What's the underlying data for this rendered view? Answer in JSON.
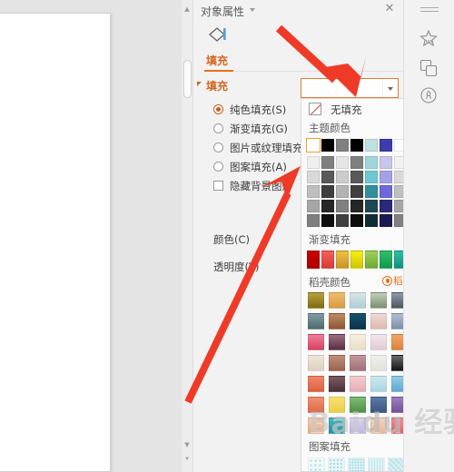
{
  "panel": {
    "title": "对象属性",
    "caret_icon": "chevron-down-icon",
    "close_icon": "close-icon",
    "shape_icon": "shape-fill-icon",
    "tab_label": "填充",
    "section_label": "填充",
    "options": [
      {
        "label": "纯色填充(S)",
        "type": "radio",
        "selected": true
      },
      {
        "label": "渐变填充(G)",
        "type": "radio",
        "selected": false
      },
      {
        "label": "图片或纹理填充(",
        "type": "radio",
        "selected": false
      },
      {
        "label": "图案填充(A)",
        "type": "radio",
        "selected": false
      },
      {
        "label": "隐藏背景图形",
        "type": "checkbox",
        "selected": false
      }
    ],
    "color_label": "颜色(C)",
    "transparency_label": "透明度(T)"
  },
  "fill_button": {
    "value": "",
    "arrow_icon": "dropdown-arrow-icon",
    "border_color": "#e07b33"
  },
  "popup": {
    "no_fill_label": "无填充",
    "no_fill_icon": "no-fill-icon",
    "theme_colors_label": "主题颜色",
    "gradient_fill_label": "渐变填充",
    "dk_colors_label": "稻壳颜色",
    "dk_member_badge": "稻壳会员专享",
    "dk_badge_icon": "member-crown-icon",
    "pattern_fill_label": "图案填充",
    "theme_base": [
      "#ffffff",
      "#000000",
      "#808080",
      "#000000",
      "#bfe0e3",
      "#3d3cad",
      "#ffffff",
      "#000000",
      "#dbeced",
      "#3d3cad"
    ],
    "theme_variants": [
      [
        "#f0f0f0",
        "#7f7f7f",
        "#e6e6e6",
        "#7f7f7f",
        "#9fd6db",
        "#c8c6ee",
        "#f2f2f2",
        "#7f7f7f",
        "#bfe0e3",
        "#c8c6ee"
      ],
      [
        "#d9d9d9",
        "#595959",
        "#cccccc",
        "#595959",
        "#6ec7d1",
        "#a5a0e6",
        "#d9d9d9",
        "#595959",
        "#8fd0d8",
        "#a5a0e6"
      ],
      [
        "#bfbfbf",
        "#3f3f3f",
        "#b3b3b3",
        "#3f3f3f",
        "#328e99",
        "#6f68dd",
        "#bfbfbf",
        "#3f3f3f",
        "#2f7d88",
        "#6f68dd"
      ],
      [
        "#a6a6a6",
        "#262626",
        "#808080",
        "#262626",
        "#1d4a52",
        "#2b2a7a",
        "#a6a6a6",
        "#262626",
        "#1b4049",
        "#2b2a7a"
      ],
      [
        "#7f7f7f",
        "#0d0d0d",
        "#404040",
        "#0d0d0d",
        "#0f2e33",
        "#1b1a52",
        "#808080",
        "#0d0d0d",
        "#0d272c",
        "#1b1a52"
      ]
    ],
    "gradients": [
      [
        "#c80000",
        "#b00000"
      ],
      [
        "#f2615c",
        "#d93a36"
      ],
      [
        "#f0c040",
        "#c8952a"
      ],
      [
        "#f7f010",
        "#cfc40a"
      ],
      [
        "#9ed15a",
        "#6da832"
      ],
      [
        "#2fc06a",
        "#0f9a4c"
      ],
      [
        "#2fc0a0",
        "#0e8f88"
      ],
      [
        "#1e8fd8",
        "#0d63ae"
      ],
      [
        "#203a8f",
        "#14235e"
      ],
      [
        "#8a3fc0",
        "#6a28a0"
      ]
    ],
    "dk_colors": [
      [
        [
          "#b7a23c",
          "#7e6a16"
        ],
        [
          "#eebb6d",
          "#d89c42"
        ],
        [
          "#d6e6e2",
          "#aecfd6"
        ],
        [
          "#bfd0bc",
          "#7d8f6b"
        ],
        [
          "#8f9aaa",
          "#4d5560"
        ],
        [
          "#a8565f",
          "#8d4552"
        ],
        [
          "#8ec3ae",
          "#5f9b89"
        ]
      ],
      [
        [
          "#7e9ca3",
          "#4e6a6c"
        ],
        [
          "#c08a66",
          "#8e5534"
        ],
        [
          "#16506f",
          "#0c3348"
        ],
        [
          "#f0d9d5",
          "#dcb8b4"
        ],
        [
          "#b2bdd2",
          "#808da8"
        ],
        [
          "#b3b054",
          "#8a8533"
        ],
        [
          "#7b8d7f",
          "#44564a"
        ]
      ],
      [
        [
          "#ef7f9c",
          "#d6415f"
        ],
        [
          "#9b6d80",
          "#5c2f45"
        ],
        [
          "#f7efdf",
          "#eadfc6"
        ],
        [
          "#f3e6ec",
          "#e2cad6"
        ],
        [
          "#efa567",
          "#e0833a"
        ],
        [
          "#6e6354",
          "#3e372c"
        ],
        [
          "#cfe0c6",
          "#a8c59b"
        ]
      ],
      [
        [
          "#eee5d9",
          "#ded0bd"
        ],
        [
          "#c08d79",
          "#9a6450"
        ],
        [
          "#c2989a",
          "#a2707a"
        ],
        [
          "#f0f0ec",
          "#e2e2dc"
        ],
        [
          "#6a6a6a",
          "#161616"
        ],
        [
          "#f2706a",
          "#d74b46"
        ],
        [
          "#ef6f8e",
          "#dc4468"
        ]
      ],
      [
        [
          "#f0876a",
          "#e05f3e"
        ],
        [
          "#7d5a62",
          "#4b2f3a"
        ],
        [
          "#f3cdd0",
          "#e4aeb4"
        ],
        [
          "#cfe9ee",
          "#a7d6e0"
        ],
        [
          "#94cbe8",
          "#5fa9d0"
        ],
        [
          "#eee79a",
          "#ddd470"
        ],
        [
          "#f37f7c",
          "#e05552"
        ]
      ],
      [
        [
          "#f09070",
          "#e06a47"
        ],
        [
          "#f6e071",
          "#ecd048"
        ],
        [
          "#7fbb74",
          "#4c9246"
        ],
        [
          "#5b7aa8",
          "#3a5681"
        ],
        [
          "#9b7fbd",
          "#72529b"
        ],
        [
          "#f06fa0",
          "#dc4680"
        ],
        [
          "#a9e0ec",
          "#78c8dc"
        ]
      ],
      [
        [
          "#f5c9a9",
          "#ecae83"
        ],
        [
          "#4cb6c0",
          "#2a919c"
        ],
        [
          "#ded3f0",
          "#c2b3e2"
        ],
        [
          "#f5d3bd",
          "#e8b79a"
        ],
        [
          "#f28a93",
          "#e0626e"
        ],
        [
          "#b4e0b8",
          "#86c78f"
        ],
        [
          "#f49c9c",
          "#e5746f"
        ]
      ]
    ],
    "patterns": [
      "#f0fafb",
      "#e9f6f8",
      "#eaf7f8",
      "#e0f2f5",
      "#d8eef2",
      "#cfeaef"
    ]
  },
  "rail": {
    "items": [
      {
        "icon": "hamburger-icon"
      },
      {
        "icon": "sparkle-star-icon"
      },
      {
        "icon": "layers-icon"
      },
      {
        "icon": "gear-badge-icon"
      }
    ]
  },
  "scrollbar": {
    "up_icon": "scroll-up-icon",
    "down_icon_1": "scroll-down-icon",
    "down_icon_2": "scroll-page-down-icon"
  },
  "watermark": {
    "text_a": "Bai",
    "text_b": "du",
    "text_c": "经验"
  }
}
